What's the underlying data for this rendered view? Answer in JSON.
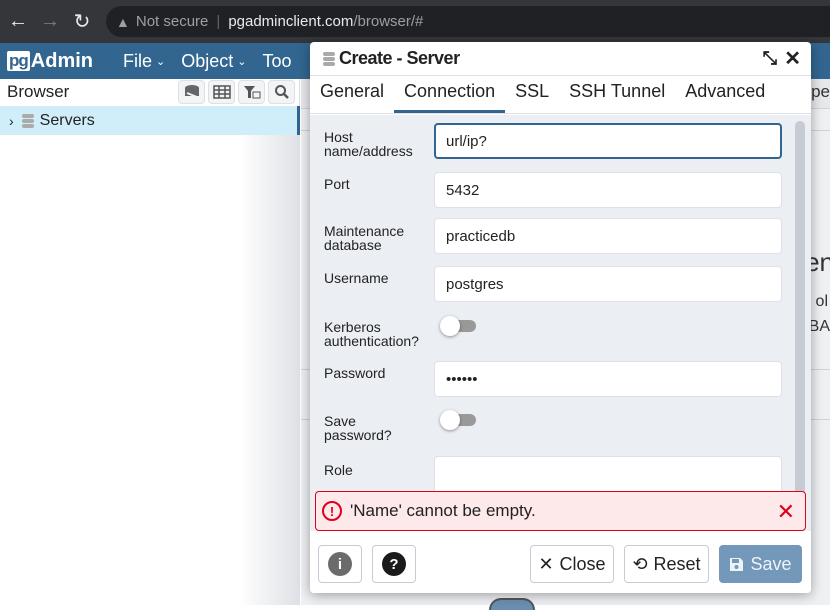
{
  "browser_chrome": {
    "security_label": "Not secure",
    "url_host": "pgadminclient.com",
    "url_path": "/browser/#",
    "back_icon": "arrow-left-icon",
    "forward_icon": "arrow-right-icon",
    "reload_icon": "reload-icon",
    "warning_icon": "warning-triangle-icon"
  },
  "app": {
    "logo_pg": "pg",
    "logo_admin": "Admin",
    "menu": [
      {
        "label": "File"
      },
      {
        "label": "Object"
      },
      {
        "label": "Too"
      }
    ],
    "brand_color": "#326690"
  },
  "browser_panel": {
    "title": "Browser",
    "toolbar_icons": [
      "query-tool-icon",
      "view-data-icon",
      "filtered-rows-icon",
      "search-objects-icon"
    ],
    "tree": [
      {
        "label": "Servers",
        "expanded": false,
        "selected": true
      }
    ]
  },
  "background_peek": {
    "tab_fragment": "pe",
    "big_fragment": "en",
    "line_a": "ol",
    "line_b": "DBA"
  },
  "dialog": {
    "title": "Create - Server",
    "tabs": [
      {
        "label": "General",
        "active": false
      },
      {
        "label": "Connection",
        "active": true
      },
      {
        "label": "SSL",
        "active": false
      },
      {
        "label": "SSH Tunnel",
        "active": false
      },
      {
        "label": "Advanced",
        "active": false
      }
    ],
    "fields": {
      "host": {
        "label_1": "Host",
        "label_2": "name/address",
        "value": "url/ip?"
      },
      "port": {
        "label": "Port",
        "value": "5432"
      },
      "maintenance_db": {
        "label_1": "Maintenance",
        "label_2": "database",
        "value": "practicedb"
      },
      "username": {
        "label": "Username",
        "value": "postgres"
      },
      "kerberos": {
        "label_1": "Kerberos",
        "label_2": "authentication?",
        "enabled": false
      },
      "password": {
        "label": "Password",
        "value": "••••••"
      },
      "save_password": {
        "label_1": "Save",
        "label_2": "password?",
        "enabled": false
      },
      "role": {
        "label": "Role",
        "value": ""
      }
    },
    "error": {
      "message": "'Name' cannot be empty.",
      "icon_text": "!",
      "dismiss": "✕",
      "color": "#e0001b"
    },
    "footer": {
      "info_icon": "i",
      "help_icon": "?",
      "close_label": "Close",
      "reset_label": "Reset",
      "save_label": "Save",
      "save_enabled": false
    }
  }
}
